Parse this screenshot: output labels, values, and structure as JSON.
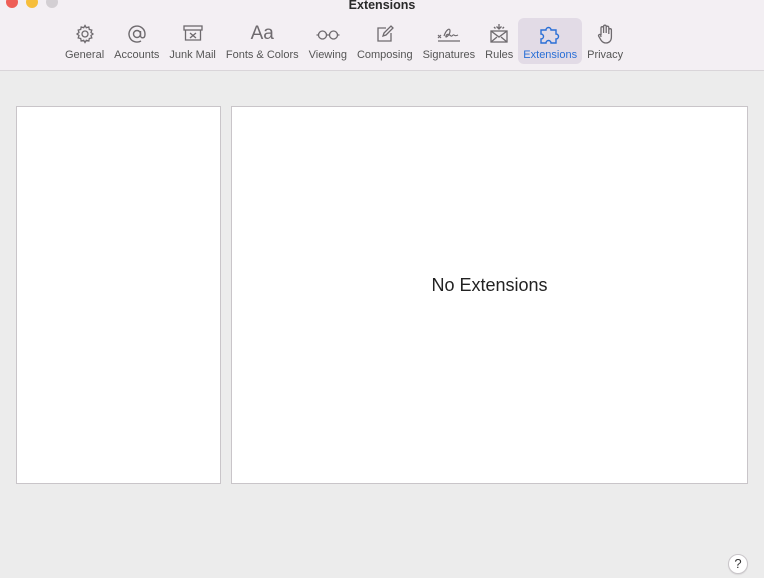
{
  "window": {
    "title": "Extensions"
  },
  "tabs": [
    {
      "label": "General",
      "icon": "gear-icon",
      "selected": false
    },
    {
      "label": "Accounts",
      "icon": "at-icon",
      "selected": false
    },
    {
      "label": "Junk Mail",
      "icon": "junk-mail-icon",
      "selected": false
    },
    {
      "label": "Fonts & Colors",
      "icon": "fonts-icon",
      "selected": false
    },
    {
      "label": "Viewing",
      "icon": "glasses-icon",
      "selected": false
    },
    {
      "label": "Composing",
      "icon": "compose-icon",
      "selected": false
    },
    {
      "label": "Signatures",
      "icon": "signature-icon",
      "selected": false
    },
    {
      "label": "Rules",
      "icon": "rules-icon",
      "selected": false
    },
    {
      "label": "Extensions",
      "icon": "puzzle-icon",
      "selected": true
    },
    {
      "label": "Privacy",
      "icon": "hand-icon",
      "selected": false
    }
  ],
  "fonts_icon_glyph": "Aa",
  "main": {
    "empty_message": "No Extensions"
  },
  "help": {
    "label": "?"
  },
  "colors": {
    "accent": "#2a6fd6",
    "selected_tab_bg": "#e2dbe6"
  }
}
